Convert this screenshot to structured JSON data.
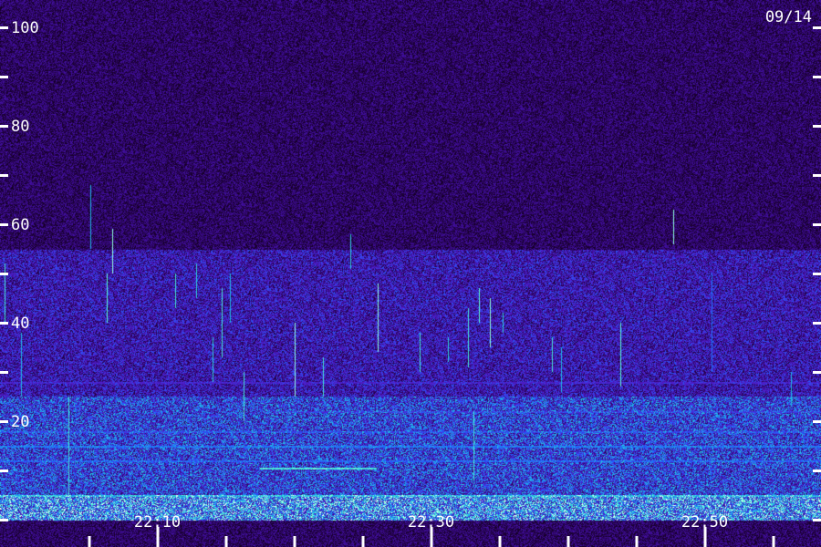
{
  "chart_data": {
    "type": "heatmap",
    "title": "",
    "date_label": "09/14",
    "xlabel": "",
    "ylabel": "",
    "y_range": [
      0,
      100
    ],
    "y_ticks": [
      0,
      10,
      20,
      30,
      40,
      50,
      60,
      70,
      80,
      90,
      100
    ],
    "y_tick_labels": [
      {
        "value": 100,
        "label": "100"
      },
      {
        "value": 80,
        "label": "80"
      },
      {
        "value": 60,
        "label": "60"
      },
      {
        "value": 40,
        "label": "40"
      },
      {
        "value": 20,
        "label": "20"
      }
    ],
    "x_range_minutes": [
      0,
      60
    ],
    "x_ticks_minutes": [
      6.5,
      11.5,
      16.5,
      21.5,
      26.5,
      31.5,
      36.5,
      41.5,
      46.5,
      51.5,
      56.5
    ],
    "x_major_ticks": [
      {
        "minute": 11.5,
        "label": "22:10"
      },
      {
        "minute": 31.5,
        "label": "22:30"
      },
      {
        "minute": 51.5,
        "label": "22:50"
      }
    ],
    "colormap": [
      "#000000",
      "#1a0030",
      "#3a0a8a",
      "#5020d0",
      "#2060ff",
      "#20c0e0",
      "#60ffd0",
      "#ffffff"
    ],
    "noise_floor_level": 0.28,
    "bands": [
      {
        "y_from": 25,
        "y_to": 55,
        "level": 0.45
      },
      {
        "y_from": 5,
        "y_to": 25,
        "level": 0.6
      },
      {
        "y_from": 0,
        "y_to": 5,
        "level": 0.8
      }
    ],
    "horizontal_lines": [
      {
        "y": 18,
        "x_from": 0,
        "x_to": 60,
        "level": 0.55
      },
      {
        "y": 15,
        "x_from": 0,
        "x_to": 60,
        "level": 0.65
      },
      {
        "y": 12,
        "x_from": 0,
        "x_to": 60,
        "level": 0.6
      },
      {
        "y": 10.5,
        "x_from": 19,
        "x_to": 27.5,
        "level": 0.9
      },
      {
        "y": 5,
        "x_from": 0,
        "x_to": 60,
        "level": 0.75
      },
      {
        "y": 22,
        "x_from": 20,
        "x_to": 60,
        "level": 0.5
      },
      {
        "y": 28,
        "x_from": 0,
        "x_to": 60,
        "level": 0.45
      }
    ],
    "vertical_events": [
      {
        "minute": 0.3,
        "y_from": 40,
        "y_to": 52,
        "level": 0.8
      },
      {
        "minute": 1.5,
        "y_from": 25,
        "y_to": 38,
        "level": 0.7
      },
      {
        "minute": 5,
        "y_from": 5,
        "y_to": 25,
        "level": 0.8
      },
      {
        "minute": 6.6,
        "y_from": 55,
        "y_to": 68,
        "level": 0.7
      },
      {
        "minute": 7.8,
        "y_from": 40,
        "y_to": 50,
        "level": 0.85
      },
      {
        "minute": 8.2,
        "y_from": 50,
        "y_to": 59,
        "level": 0.9
      },
      {
        "minute": 12.8,
        "y_from": 43,
        "y_to": 50,
        "level": 0.8
      },
      {
        "minute": 14.3,
        "y_from": 45,
        "y_to": 52,
        "level": 0.75
      },
      {
        "minute": 15.5,
        "y_from": 28,
        "y_to": 37,
        "level": 0.75
      },
      {
        "minute": 16.2,
        "y_from": 33,
        "y_to": 47,
        "level": 0.8
      },
      {
        "minute": 16.8,
        "y_from": 40,
        "y_to": 50,
        "level": 0.7
      },
      {
        "minute": 17.8,
        "y_from": 20,
        "y_to": 30,
        "level": 0.8
      },
      {
        "minute": 21.5,
        "y_from": 25,
        "y_to": 40,
        "level": 0.9
      },
      {
        "minute": 23.6,
        "y_from": 25,
        "y_to": 33,
        "level": 0.8
      },
      {
        "minute": 25.6,
        "y_from": 51,
        "y_to": 58,
        "level": 0.75
      },
      {
        "minute": 27.6,
        "y_from": 34,
        "y_to": 48,
        "level": 0.9
      },
      {
        "minute": 30.7,
        "y_from": 30,
        "y_to": 38,
        "level": 0.8
      },
      {
        "minute": 32.7,
        "y_from": 32,
        "y_to": 37,
        "level": 0.75
      },
      {
        "minute": 34.2,
        "y_from": 31,
        "y_to": 43,
        "level": 0.8
      },
      {
        "minute": 34.6,
        "y_from": 8,
        "y_to": 22,
        "level": 0.8
      },
      {
        "minute": 35.0,
        "y_from": 40,
        "y_to": 47,
        "level": 0.85
      },
      {
        "minute": 35.8,
        "y_from": 35,
        "y_to": 45,
        "level": 0.9
      },
      {
        "minute": 36.7,
        "y_from": 38,
        "y_to": 42,
        "level": 0.75
      },
      {
        "minute": 40.3,
        "y_from": 30,
        "y_to": 37,
        "level": 0.8
      },
      {
        "minute": 41.0,
        "y_from": 26,
        "y_to": 35,
        "level": 0.7
      },
      {
        "minute": 45.3,
        "y_from": 27,
        "y_to": 40,
        "level": 0.85
      },
      {
        "minute": 49.2,
        "y_from": 56,
        "y_to": 63,
        "level": 0.9
      },
      {
        "minute": 52.0,
        "y_from": 30,
        "y_to": 50,
        "level": 0.6
      },
      {
        "minute": 57.8,
        "y_from": 23,
        "y_to": 30,
        "level": 0.7
      }
    ]
  }
}
